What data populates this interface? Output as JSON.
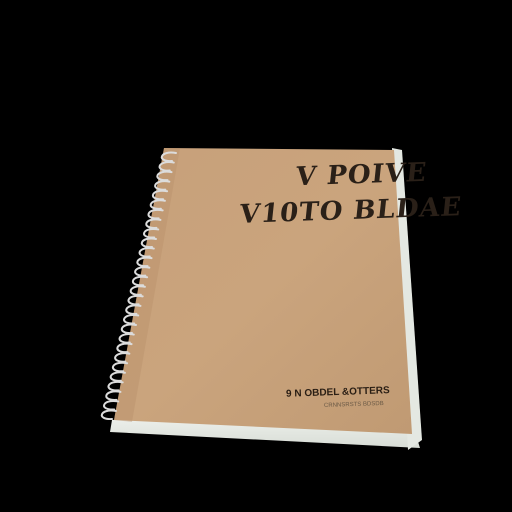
{
  "cover": {
    "title_line_1": "V POIVE",
    "title_line_2": "V10TO BLDAE"
  },
  "publisher": {
    "line_1": "9 N OBDEL &OTTERS",
    "line_2": "CRNNSRSTS BDSDB"
  },
  "colors": {
    "background": "#000000",
    "cover": "#c9a27a",
    "spine_pages": "#e8ece6",
    "spiral": "#dcdcdc",
    "ink": "#2a2018"
  }
}
